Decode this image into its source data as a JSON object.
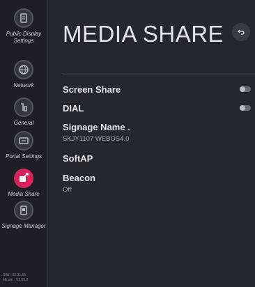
{
  "sidebar": {
    "items": [
      {
        "label": "Public Display Settings",
        "icon": "display-settings-icon"
      },
      {
        "label": "Network",
        "icon": "globe-icon"
      },
      {
        "label": "General",
        "icon": "general-settings-icon"
      },
      {
        "label": "Portal Settings",
        "icon": "portal-icon"
      },
      {
        "label": "Media Share",
        "icon": "media-share-icon"
      },
      {
        "label": "Signage Manager",
        "icon": "signage-manager-icon"
      }
    ],
    "active_item": "Media Share",
    "version_line1": "S/W : 02.31.66",
    "version_line2": "Micom : V3.09.8"
  },
  "main": {
    "title": "MEDIA SHARE",
    "rows": {
      "screen_share": {
        "label": "Screen Share",
        "toggle": "off"
      },
      "dial": {
        "label": "DIAL",
        "toggle": "off"
      },
      "signage_name": {
        "label": "Signage Name",
        "chevron": "⌄",
        "value": "SKJY1107 WEBOS4.0"
      },
      "softap": {
        "label": "SoftAP"
      },
      "beacon": {
        "label": "Beacon",
        "value": "Off"
      }
    }
  },
  "colors": {
    "accent": "#d6245a",
    "background": "#26262d",
    "sidebar": "#1e1e24"
  }
}
